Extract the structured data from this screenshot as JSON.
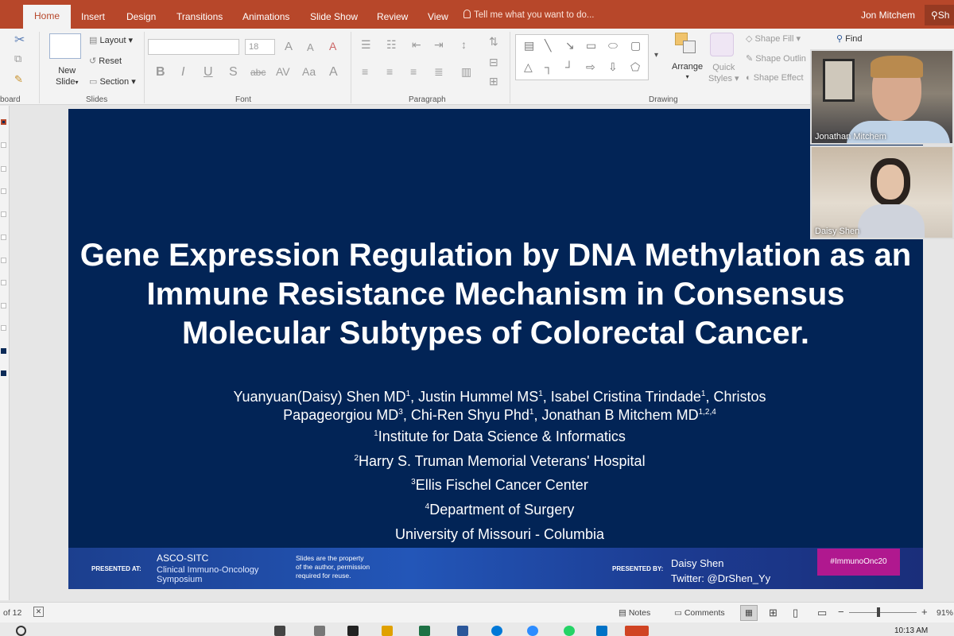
{
  "tabs": {
    "home": "Home",
    "insert": "Insert",
    "design": "Design",
    "transitions": "Transitions",
    "animations": "Animations",
    "slideshow": "Slide Show",
    "review": "Review",
    "view": "View"
  },
  "tellme": "Tell me what you want to do...",
  "user": "Jon Mitchem",
  "share": "Sh",
  "ribbon": {
    "clipboard": "board",
    "new_slide_line1": "New",
    "new_slide_line2": "Slide",
    "layout": "Layout",
    "reset": "Reset",
    "section": "Section",
    "slides_group": "Slides",
    "font_size": "18",
    "font_group": "Font",
    "paragraph_group": "Paragraph",
    "drawing_group": "Drawing",
    "arrange": "Arrange",
    "quick_styles_1": "Quick",
    "quick_styles_2": "Styles",
    "shape_fill": "Shape Fill",
    "shape_outline": "Shape Outlin",
    "shape_effects": "Shape Effect",
    "find": "Find"
  },
  "slide": {
    "title_line1": "Gene Expression Regulation by DNA Methylation as an",
    "title_line2": "Immune Resistance Mechanism in Consensus",
    "title_line3": "Molecular Subtypes of Colorectal Cancer.",
    "authors_a": "Yuanyuan(Daisy) Shen MD",
    "authors_b": ", Justin Hummel MS",
    "authors_c": ", Isabel Cristina Trindade",
    "authors_d": ", Christos",
    "authors_e": "Papageorgiou MD",
    "authors_f": ", Chi-Ren Shyu Phd",
    "authors_g": ", Jonathan B Mitchem MD",
    "sup1": "1",
    "sup3": "3",
    "sup124": "1,2,4",
    "aff1_sup": "1",
    "aff1": "Institute for Data Science & Informatics",
    "aff2_sup": "2",
    "aff2": "Harry S. Truman Memorial Veterans' Hospital",
    "aff3_sup": "3",
    "aff3": "Ellis Fischel Cancer Center",
    "aff4_sup": "4",
    "aff4": "Department of Surgery",
    "aff5": "University of Missouri - Columbia"
  },
  "footer": {
    "presented_at": "PRESENTED AT:",
    "meeting": "ASCO-SITC",
    "meeting_sub1": "Clinical Immuno-Oncology",
    "meeting_sub2": "Symposium",
    "note1": "Slides are the property",
    "note2": "of the author, permission",
    "note3": "required for reuse.",
    "presented_by": "PRESENTED BY:",
    "presenter": "Daisy Shen",
    "twitter": "Twitter: @DrShen_Yy",
    "hashtag": "#ImmunoOnc20"
  },
  "video": {
    "person1": "Jonathan Mitchem",
    "person2": "Daisy Shen"
  },
  "status": {
    "slide_count": "of 12",
    "notes": "Notes",
    "comments": "Comments",
    "zoom": "91%",
    "zoom_minus": "−",
    "zoom_plus": "+",
    "time": "10:13 AM"
  },
  "colors": {
    "ribbon_red": "#b7472a",
    "slide_navy": "#022456",
    "hashtag_magenta": "#b0188f"
  }
}
